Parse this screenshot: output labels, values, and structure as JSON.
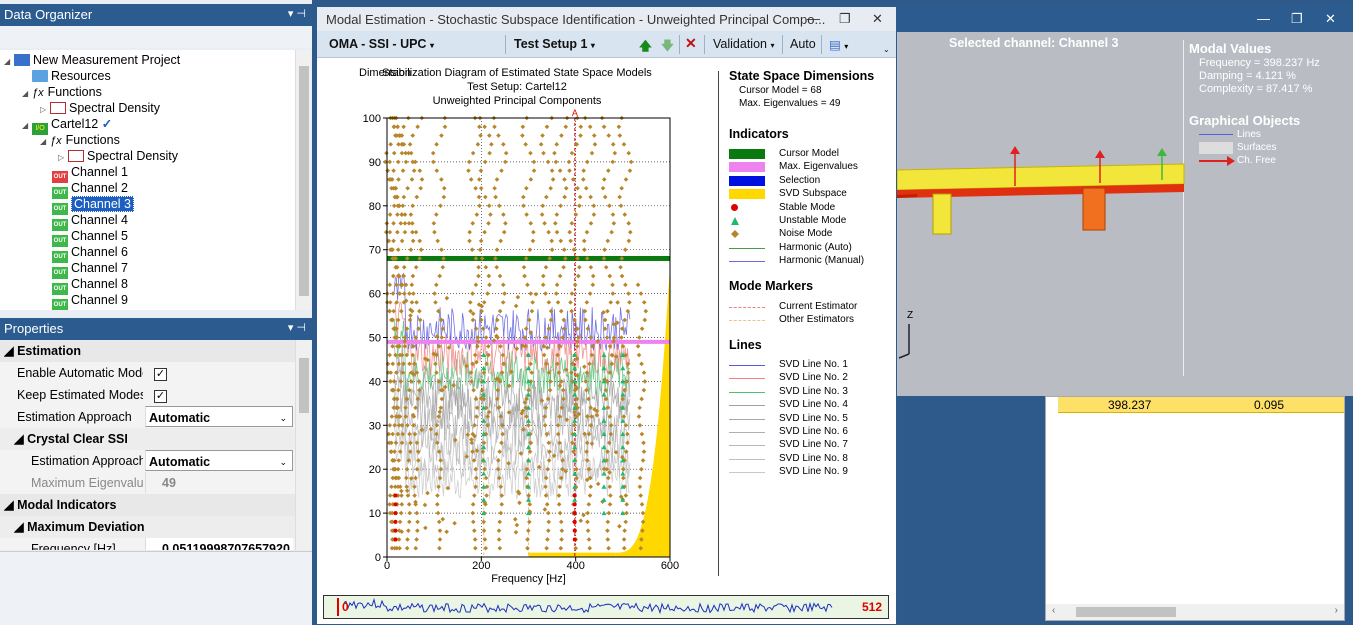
{
  "data_organizer": {
    "title": "Data Organizer",
    "tree": [
      {
        "label": "New Measurement Project"
      },
      {
        "label": "Resources"
      },
      {
        "label": "Functions"
      },
      {
        "label": "Spectral Density"
      },
      {
        "label": "Cartel12"
      },
      {
        "label": "Functions"
      },
      {
        "label": "Spectral Density"
      },
      {
        "label": "Channel 1"
      },
      {
        "label": "Channel 2"
      },
      {
        "label": "Channel 3"
      },
      {
        "label": "Channel 4"
      },
      {
        "label": "Channel 5"
      },
      {
        "label": "Channel 6"
      },
      {
        "label": "Channel 7"
      },
      {
        "label": "Channel 8"
      },
      {
        "label": "Channel 9"
      }
    ],
    "checkmark": "✓"
  },
  "properties": {
    "title": "Properties",
    "rows": {
      "estimation": "Estimation",
      "enable_auto": "Enable Automatic Modes",
      "keep_estimated": "Keep Estimated Modes",
      "estimation_approach": "Estimation Approach",
      "estimation_approach_value": "Automatic",
      "crystal_clear": "Crystal Clear SSI",
      "estimation_approach2": "Estimation Approach",
      "estimation_approach2_value": "Automatic",
      "max_eigen": "Maximum Eigenvalues",
      "max_eigen_value": "49",
      "modal_indicators": "Modal Indicators",
      "max_deviation": "Maximum Deviation",
      "frequency": "Frequency [Hz]",
      "frequency_value": "0.05119998707657920"
    }
  },
  "dialog": {
    "title": "Modal Estimation - Stochastic Subspace Identification - Unweighted Principal Compo...",
    "toolbar": {
      "mode": "OMA - SSI - UPC",
      "setup": "Test Setup 1",
      "validation": "Validation",
      "auto": "Auto"
    }
  },
  "chart_data": {
    "type": "scatter",
    "title": "Stabilization Diagram of Estimated State Space Models",
    "overlap_label": "Dimension",
    "subtitle1": "Test Setup: Cartel12",
    "subtitle2": "Unweighted Principal Components",
    "xlabel": "Frequency [Hz]",
    "ylabel": "",
    "xlim": [
      0,
      600
    ],
    "ylim": [
      0,
      100
    ],
    "xticks": [
      "0",
      "200",
      "400",
      "600"
    ],
    "yticks": [
      "0",
      "10",
      "20",
      "30",
      "40",
      "50",
      "60",
      "70",
      "80",
      "90",
      "100"
    ],
    "cursor_model": 68,
    "max_eigen": 49,
    "selection_freq": 398.237,
    "marker_label": "A",
    "noise_columns_hz": [
      9,
      14,
      20,
      28,
      45,
      62,
      110,
      185,
      208,
      240,
      300,
      340,
      368,
      398,
      428,
      470,
      505,
      540
    ],
    "stable_columns_hz": [
      18,
      398
    ],
    "unstable_columns_hz": [
      205,
      300,
      398,
      460,
      500
    ]
  },
  "legend": {
    "dims_title": "State Space Dimensions",
    "cursor_model": "Cursor Model = 68",
    "max_eigen": "Max. Eigenvalues = 49",
    "indicators_title": "Indicators",
    "indicators": [
      {
        "label": "Cursor Model",
        "color": "#0a7a10"
      },
      {
        "label": "Max. Eigenvalues",
        "color": "#ee82ee"
      },
      {
        "label": "Selection",
        "color": "#0010e0"
      },
      {
        "label": "SVD Subspace",
        "color": "#ffd800"
      },
      {
        "label": "Stable Mode",
        "color": "#e00000"
      },
      {
        "label": "Unstable Mode",
        "color": "#22b870"
      },
      {
        "label": "Noise Mode",
        "color": "#b8862a"
      },
      {
        "label": "Harmonic (Auto)",
        "color": "#4a9a4a"
      },
      {
        "label": "Harmonic (Manual)",
        "color": "#6a6ae0"
      }
    ],
    "markers_title": "Mode Markers",
    "markers": [
      {
        "label": "Current Estimator",
        "color": "#f08080"
      },
      {
        "label": "Other Estimators",
        "color": "#f0c090"
      }
    ],
    "lines_title": "Lines",
    "lines": [
      {
        "label": "SVD Line No. 1",
        "color": "#5a5ae0"
      },
      {
        "label": "SVD Line No. 2",
        "color": "#f08080"
      },
      {
        "label": "SVD Line No. 3",
        "color": "#50c070"
      },
      {
        "label": "SVD Line No. 4",
        "color": "#a0a0a0"
      },
      {
        "label": "SVD Line No. 5",
        "color": "#a8a8a8"
      },
      {
        "label": "SVD Line No. 6",
        "color": "#b0b0b0"
      },
      {
        "label": "SVD Line No. 7",
        "color": "#b8b8b8"
      },
      {
        "label": "SVD Line No. 8",
        "color": "#c0c0c0"
      },
      {
        "label": "SVD Line No. 9",
        "color": "#c8c8c8"
      }
    ]
  },
  "spectrum_bar": {
    "start": "0",
    "end": "512"
  },
  "view3d": {
    "selected_channel": "Selected channel: Channel 3",
    "modal_values_title": "Modal Values",
    "frequency": "Frequency = 398.237 Hz",
    "damping": "Damping = 4.121 %",
    "complexity": "Complexity = 87.417 %",
    "graphical_title": "Graphical Objects",
    "go_lines": "Lines",
    "go_surfaces": "Surfaces",
    "go_chfree": "Ch. Free",
    "axis_z": "Z"
  },
  "table": {
    "freq": "398.237",
    "damp": "0.095"
  }
}
